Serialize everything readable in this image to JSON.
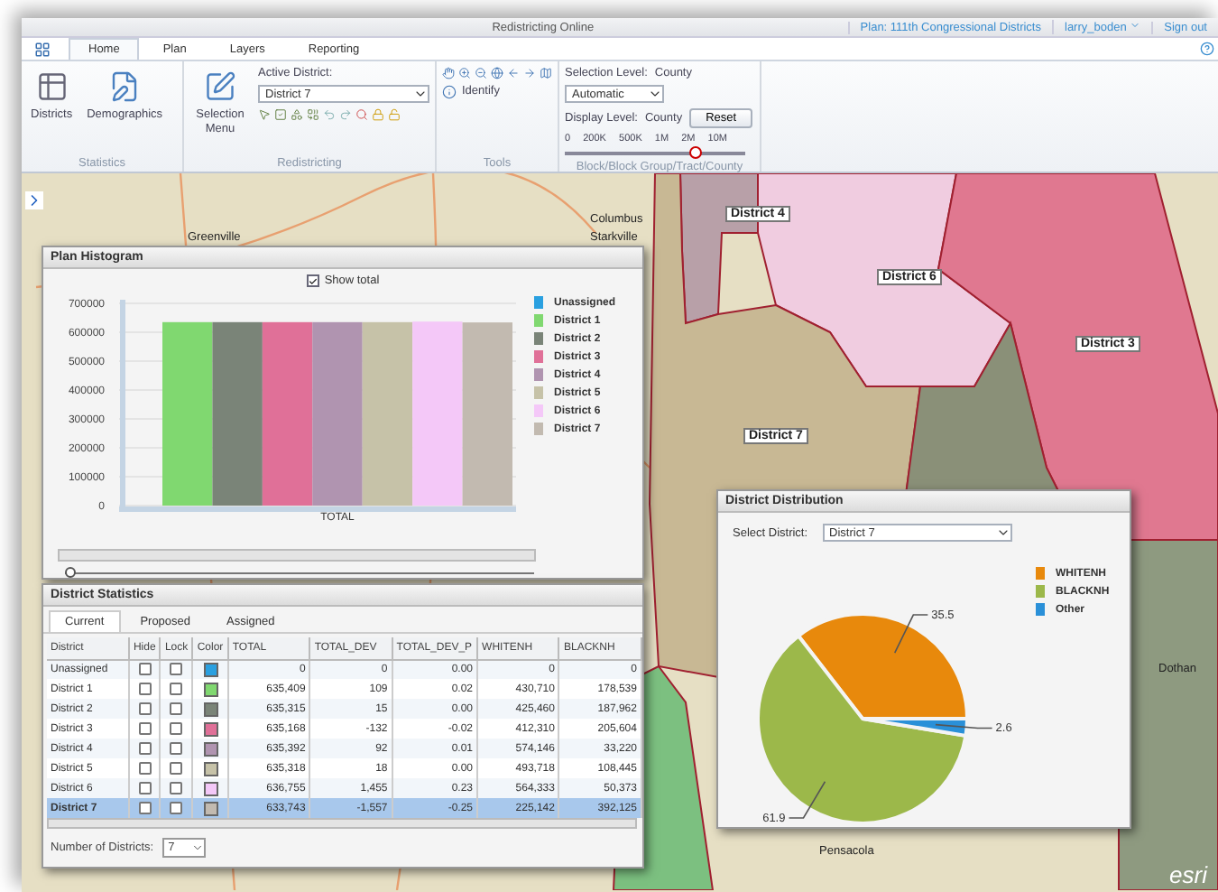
{
  "app": {
    "title": "Redistricting Online",
    "plan_link": "Plan: 111th Congressional Districts",
    "user": "larry_boden",
    "sign_out": "Sign out"
  },
  "tabs": [
    {
      "label": "Home",
      "selected": true
    },
    {
      "label": "Plan",
      "selected": false
    },
    {
      "label": "Layers",
      "selected": false
    },
    {
      "label": "Reporting",
      "selected": false
    }
  ],
  "ribbon": {
    "statistics": {
      "label": "Statistics",
      "buttons": [
        "Districts",
        "Demographics"
      ]
    },
    "redistricting": {
      "label": "Redistricting",
      "selection_menu": "Selection Menu",
      "active_district_label": "Active District:",
      "active_district": "District 7"
    },
    "tools": {
      "label": "Tools",
      "identify": "Identify"
    },
    "levels": {
      "label": "Block/Block Group/Tract/County",
      "selection_level": "Selection Level:",
      "selection_value": "County",
      "mode": "Automatic",
      "display_level": "Display Level:",
      "display_value": "County",
      "reset": "Reset",
      "scale_ticks": [
        "0",
        "200K",
        "500K",
        "1M",
        "2M",
        "10M"
      ],
      "level": 0.72
    }
  },
  "map": {
    "places": [
      "Greenville",
      "Columbus",
      "Starkville",
      "Dothan",
      "Pensacola"
    ],
    "district_labels": [
      "District 4",
      "District 6",
      "District 3",
      "District 7"
    ],
    "attribution": "esri"
  },
  "histogram": {
    "title": "Plan Histogram",
    "show_total": {
      "label": "Show total",
      "checked": true
    },
    "slider": {
      "level": 0
    },
    "chart_data": {
      "type": "bar",
      "categories": [
        "TOTAL"
      ],
      "ylim": [
        0,
        700000
      ],
      "yticks": [
        0,
        100000,
        200000,
        300000,
        400000,
        500000,
        600000,
        700000
      ],
      "grid": true,
      "series": [
        {
          "name": "Unassigned",
          "color": "#2aa0e0",
          "values": [
            0
          ]
        },
        {
          "name": "District 1",
          "color": "#80d870",
          "values": [
            635000
          ]
        },
        {
          "name": "District 2",
          "color": "#7a8478",
          "values": [
            635000
          ]
        },
        {
          "name": "District 3",
          "color": "#e07098",
          "values": [
            635000
          ]
        },
        {
          "name": "District 4",
          "color": "#b094b0",
          "values": [
            635000
          ]
        },
        {
          "name": "District 5",
          "color": "#c6c2a8",
          "values": [
            635000
          ]
        },
        {
          "name": "District 6",
          "color": "#f4c8f8",
          "values": [
            637000
          ]
        },
        {
          "name": "District 7",
          "color": "#c2bab0",
          "values": [
            634000
          ]
        }
      ]
    }
  },
  "statistics": {
    "title": "District Statistics",
    "tabs": [
      {
        "label": "Current",
        "selected": true
      },
      {
        "label": "Proposed",
        "selected": false
      },
      {
        "label": "Assigned",
        "selected": false
      }
    ],
    "columns": [
      "District",
      "Hide",
      "Lock",
      "Color",
      "TOTAL",
      "TOTAL_DEV",
      "TOTAL_DEV_P",
      "WHITENH",
      "BLACKNH"
    ],
    "rows": [
      {
        "district": "Unassigned",
        "hide": false,
        "lock": false,
        "color": "#2aa0e0",
        "values": [
          "0",
          "0",
          "0.00",
          "0",
          "0"
        ],
        "selected": false
      },
      {
        "district": "District 1",
        "hide": false,
        "lock": false,
        "color": "#80d870",
        "values": [
          "635,409",
          "109",
          "0.02",
          "430,710",
          "178,539"
        ],
        "selected": false
      },
      {
        "district": "District 2",
        "hide": false,
        "lock": false,
        "color": "#7a8478",
        "values": [
          "635,315",
          "15",
          "0.00",
          "425,460",
          "187,962"
        ],
        "selected": false
      },
      {
        "district": "District 3",
        "hide": false,
        "lock": false,
        "color": "#e07098",
        "values": [
          "635,168",
          "-132",
          "-0.02",
          "412,310",
          "205,604"
        ],
        "selected": false
      },
      {
        "district": "District 4",
        "hide": false,
        "lock": false,
        "color": "#b094b0",
        "values": [
          "635,392",
          "92",
          "0.01",
          "574,146",
          "33,220"
        ],
        "selected": false
      },
      {
        "district": "District 5",
        "hide": false,
        "lock": false,
        "color": "#c6c2a8",
        "values": [
          "635,318",
          "18",
          "0.00",
          "493,718",
          "108,445"
        ],
        "selected": false
      },
      {
        "district": "District 6",
        "hide": false,
        "lock": false,
        "color": "#f4c8f8",
        "values": [
          "636,755",
          "1,455",
          "0.23",
          "564,333",
          "50,373"
        ],
        "selected": false
      },
      {
        "district": "District 7",
        "hide": false,
        "lock": false,
        "color": "#c2bab0",
        "values": [
          "633,743",
          "-1,557",
          "-0.25",
          "225,142",
          "392,125"
        ],
        "selected": true
      }
    ],
    "count_label": "Number of Districts:",
    "count": "7"
  },
  "distribution": {
    "title": "District Distribution",
    "select_label": "Select District:",
    "selected_district": "District 7",
    "legend": [
      {
        "color": "#e8890c"
      },
      {
        "color": "#9cb84a"
      },
      {
        "color": "#2a90d8"
      }
    ],
    "chart_data": {
      "type": "pie",
      "categories": [
        "WHITENH",
        "BLACKNH",
        "Other"
      ],
      "values": [
        35.5,
        61.9,
        2.6
      ],
      "data_labels": true
    }
  }
}
